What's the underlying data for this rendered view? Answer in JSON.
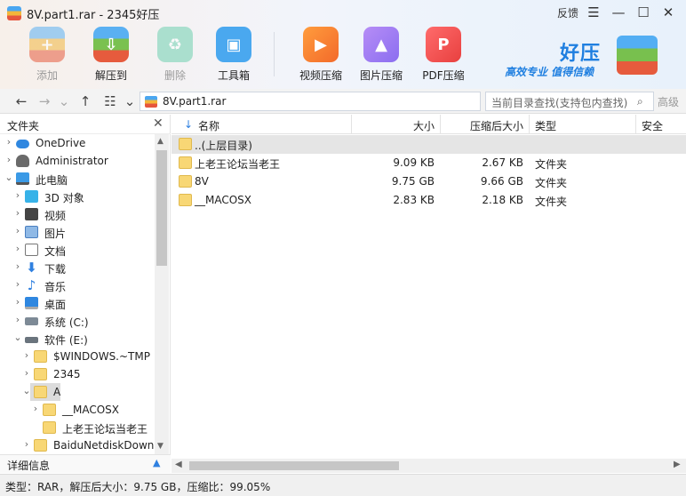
{
  "window": {
    "title": "8V.part1.rar - 2345好压",
    "feedback": "反馈",
    "menu_glyph": "☰",
    "minimize_glyph": "—",
    "maximize_glyph": "☐",
    "close_glyph": "✕"
  },
  "toolbar": [
    {
      "label": "添加",
      "icon": "archive-add-icon",
      "disabled": true
    },
    {
      "label": "解压到",
      "icon": "archive-extract-icon",
      "disabled": false
    },
    {
      "label": "删除",
      "icon": "recycle-bin-icon",
      "disabled": true
    },
    {
      "label": "工具箱",
      "icon": "toolbox-icon",
      "disabled": false
    },
    {
      "label": "视频压缩",
      "icon": "video-compress-icon",
      "disabled": false
    },
    {
      "label": "图片压缩",
      "icon": "image-compress-icon",
      "disabled": false
    },
    {
      "label": "PDF压缩",
      "icon": "pdf-compress-icon",
      "disabled": false
    }
  ],
  "brand": {
    "name": "好压",
    "slogan": "高效专业  值得信赖"
  },
  "addressbar": {
    "path": "8V.part1.rar",
    "search_placeholder": "当前目录查找(支持包内查找)",
    "advanced": "高级",
    "back_glyph": "←",
    "forward_glyph": "→",
    "dropdown_glyph": "⌄",
    "up_glyph": "↑",
    "view_glyph": "☷",
    "search_glyph": "⌕"
  },
  "leftpane": {
    "title": "文件夹",
    "close_glyph": "✕",
    "detail_label": "详细信息",
    "detail_glyph": "▲",
    "tree": [
      {
        "label": "OneDrive",
        "icon": "cloud",
        "level": 0,
        "arrow": "›"
      },
      {
        "label": "Administrator",
        "icon": "user",
        "level": 0,
        "arrow": "›"
      },
      {
        "label": "此电脑",
        "icon": "pc",
        "level": 0,
        "arrow": "⌄"
      },
      {
        "label": "3D 对象",
        "icon": "cube",
        "level": 1,
        "arrow": "›"
      },
      {
        "label": "视频",
        "icon": "video",
        "level": 1,
        "arrow": "›"
      },
      {
        "label": "图片",
        "icon": "pic",
        "level": 1,
        "arrow": "›"
      },
      {
        "label": "文档",
        "icon": "doc",
        "level": 1,
        "arrow": "›"
      },
      {
        "label": "下载",
        "icon": "down",
        "level": 1,
        "arrow": "›"
      },
      {
        "label": "音乐",
        "icon": "music",
        "level": 1,
        "arrow": "›"
      },
      {
        "label": "桌面",
        "icon": "desk",
        "level": 1,
        "arrow": "›"
      },
      {
        "label": "系统 (C:)",
        "icon": "drive",
        "level": 1,
        "arrow": "›"
      },
      {
        "label": "软件 (E:)",
        "icon": "drive2",
        "level": 1,
        "arrow": "⌄"
      },
      {
        "label": "$WINDOWS.~TMP",
        "icon": "folder",
        "level": 2,
        "arrow": "›"
      },
      {
        "label": "2345",
        "icon": "folder",
        "level": 2,
        "arrow": "›"
      },
      {
        "label": "A",
        "icon": "folder",
        "level": 2,
        "arrow": "⌄",
        "selected": true
      },
      {
        "label": "__MACOSX",
        "icon": "folder",
        "level": 3,
        "arrow": "›"
      },
      {
        "label": "上老王论坛当老王",
        "icon": "folder",
        "level": 3,
        "arrow": ""
      },
      {
        "label": "BaiduNetdiskDownl",
        "icon": "folder",
        "level": 2,
        "arrow": "›"
      }
    ]
  },
  "filelist": {
    "columns": {
      "name": "名称",
      "size": "大小",
      "packed": "压缩后大小",
      "type": "类型",
      "security": "安全"
    },
    "sort_glyph": "↓",
    "rows": [
      {
        "name": "..(上层目录)",
        "size": "",
        "packed": "",
        "type": "",
        "selected": true
      },
      {
        "name": "上老王论坛当老王",
        "size": "9.09 KB",
        "packed": "2.67 KB",
        "type": "文件夹"
      },
      {
        "name": "8V",
        "size": "9.75 GB",
        "packed": "9.66 GB",
        "type": "文件夹"
      },
      {
        "name": "__MACOSX",
        "size": "2.83 KB",
        "packed": "2.18 KB",
        "type": "文件夹"
      }
    ]
  },
  "scroll_glyphs": {
    "up": "▲",
    "down": "▼",
    "left": "◀",
    "right": "▶"
  },
  "status": {
    "text": "类型：RAR，解压后大小：9.75 GB，压缩比：99.05%"
  }
}
